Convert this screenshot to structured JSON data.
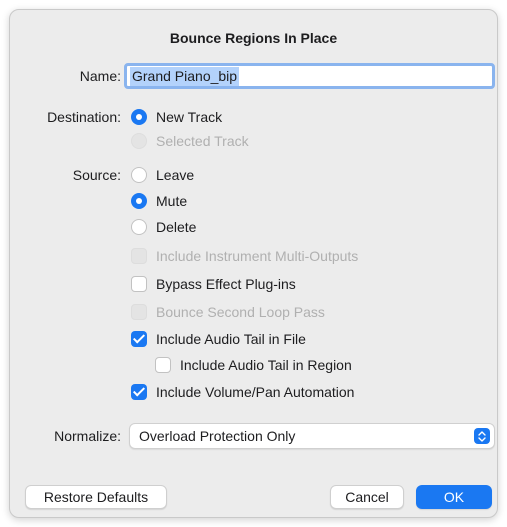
{
  "dialog": {
    "title": "Bounce Regions In Place",
    "name_label": "Name:",
    "name_value": "Grand Piano_bip",
    "destination": {
      "label": "Destination:",
      "options": [
        {
          "label": "New Track",
          "selected": true,
          "enabled": true
        },
        {
          "label": "Selected Track",
          "selected": false,
          "enabled": false
        }
      ]
    },
    "source": {
      "label": "Source:",
      "options": [
        {
          "label": "Leave",
          "selected": false
        },
        {
          "label": "Mute",
          "selected": true
        },
        {
          "label": "Delete",
          "selected": false
        }
      ]
    },
    "checkboxes": [
      {
        "label": "Include Instrument Multi-Outputs",
        "checked": false,
        "enabled": false
      },
      {
        "label": "Bypass Effect Plug-ins",
        "checked": false,
        "enabled": true
      },
      {
        "label": "Bounce Second Loop Pass",
        "checked": false,
        "enabled": false
      },
      {
        "label": "Include Audio Tail in File",
        "checked": true,
        "enabled": true
      },
      {
        "label": "Include Audio Tail in Region",
        "checked": false,
        "enabled": true
      },
      {
        "label": "Include Volume/Pan Automation",
        "checked": true,
        "enabled": true
      }
    ],
    "normalize": {
      "label": "Normalize:",
      "value": "Overload Protection Only"
    },
    "buttons": {
      "restore": "Restore Defaults",
      "cancel": "Cancel",
      "ok": "OK"
    },
    "colors": {
      "accent": "#1a78f2",
      "dialog_bg": "#ececec",
      "disabled_text": "#b0b0b0",
      "focus_ring": "#8ab4ee"
    }
  }
}
